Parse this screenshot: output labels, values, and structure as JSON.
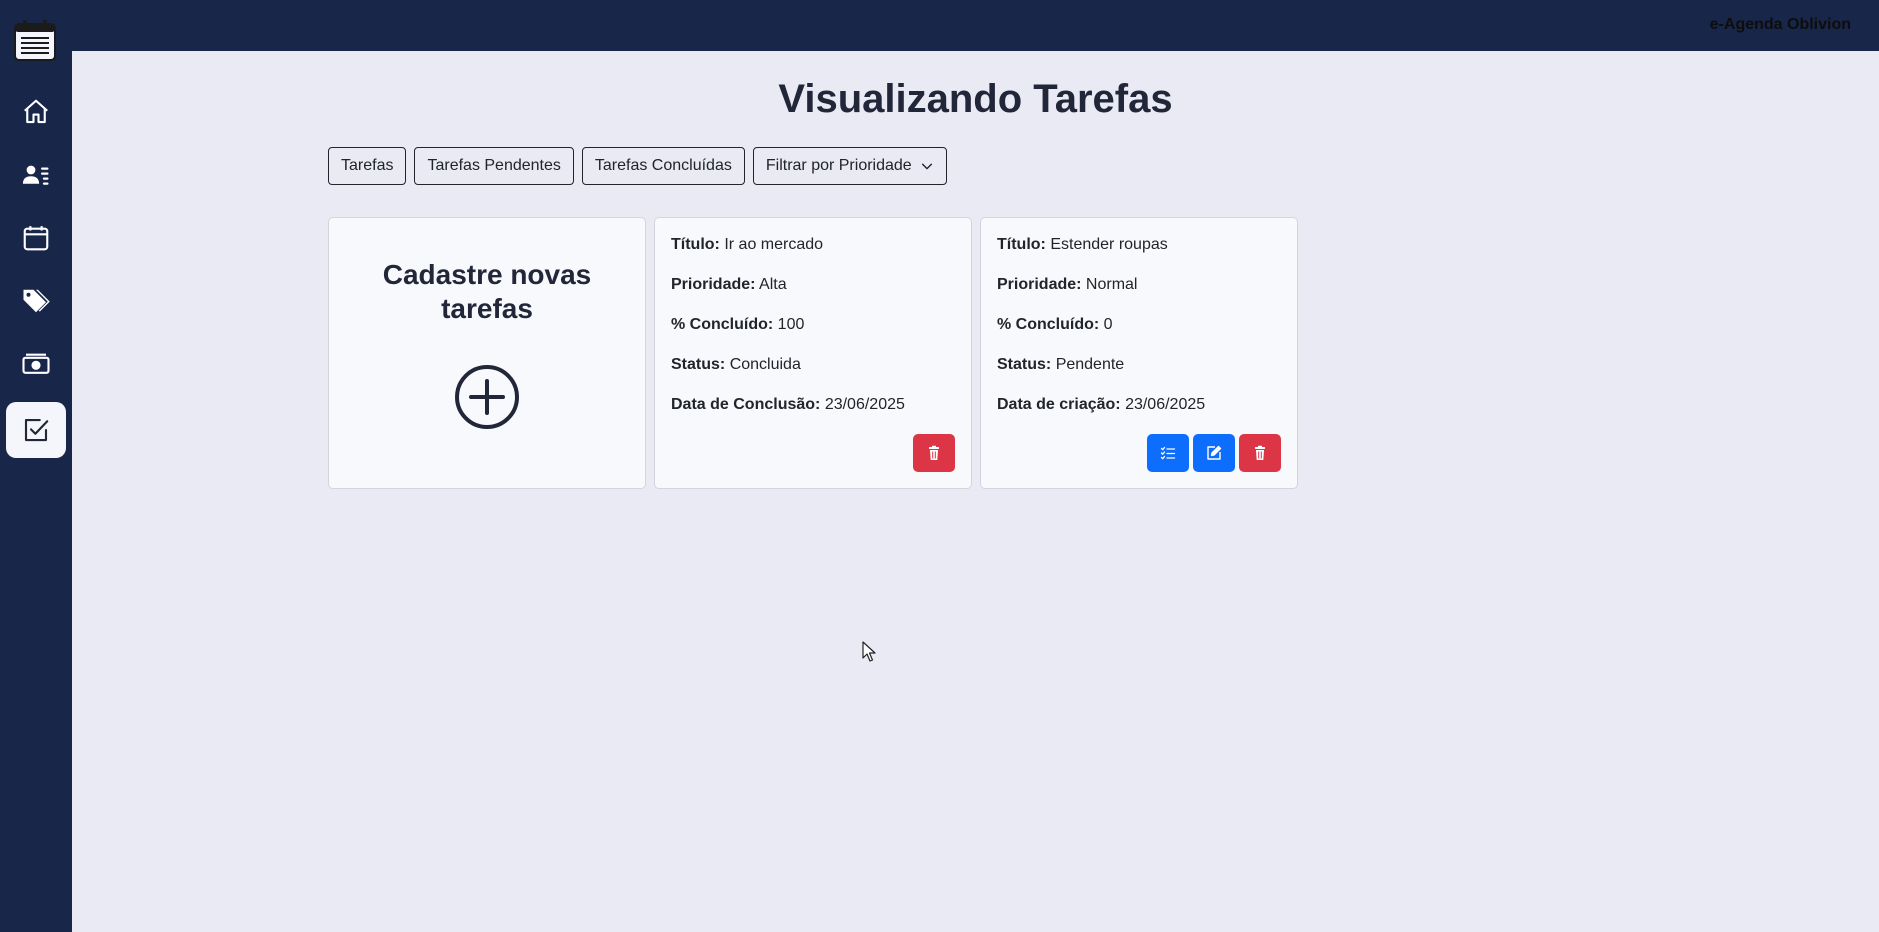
{
  "app": {
    "brand": "e-Agenda Oblivion"
  },
  "sidebar": {
    "items": [
      {
        "name": "home",
        "icon": "house-icon"
      },
      {
        "name": "contacts",
        "icon": "person-lines-icon"
      },
      {
        "name": "appointments",
        "icon": "calendar-icon"
      },
      {
        "name": "categories",
        "icon": "tags-icon"
      },
      {
        "name": "expenses",
        "icon": "cash-icon"
      },
      {
        "name": "tasks",
        "icon": "check-square-icon",
        "active": true
      }
    ]
  },
  "page": {
    "title": "Visualizando Tarefas"
  },
  "filters": {
    "all": "Tarefas",
    "pending": "Tarefas Pendentes",
    "done": "Tarefas Concluídas",
    "priority": "Filtrar por Prioridade"
  },
  "new_card": {
    "title": "Cadastre novas tarefas",
    "icon": "plus-circle-icon"
  },
  "tasks": [
    {
      "title_label": "Título:",
      "title": "Ir ao mercado",
      "priority_label": "Prioridade:",
      "priority": "Alta",
      "percent_label": "% Concluído:",
      "percent": "100",
      "status_label": "Status:",
      "status": "Concluida",
      "date_label": "Data de Conclusão:",
      "date": "23/06/2025"
    },
    {
      "title_label": "Título:",
      "title": "Estender roupas",
      "priority_label": "Prioridade:",
      "priority": "Normal",
      "percent_label": "% Concluído:",
      "percent": "0",
      "status_label": "Status:",
      "status": "Pendente",
      "date_label": "Data de criação:",
      "date": "23/06/2025"
    }
  ],
  "colors": {
    "nav_bg": "#18264a",
    "page_bg": "#e9eaf4",
    "danger": "#dc3545",
    "primary": "#0d6efd"
  }
}
